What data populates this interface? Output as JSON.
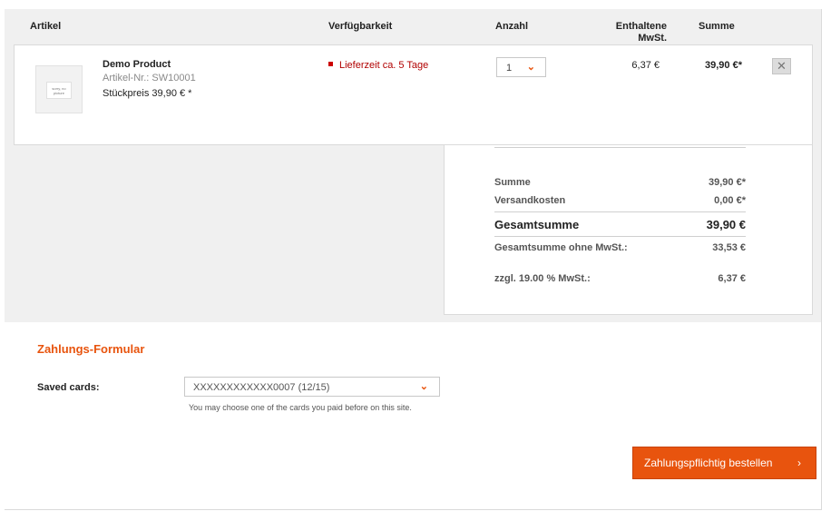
{
  "table_headers": {
    "article": "Artikel",
    "availability": "Verfügbarkeit",
    "quantity": "Anzahl",
    "tax": "Enthaltene MwSt.",
    "sum": "Summe"
  },
  "item": {
    "image_text": "sorry, no picture",
    "name": "Demo Product",
    "article_number": "Artikel-Nr.: SW10001",
    "unit_price": "Stückpreis 39,90 € *",
    "availability": "Lieferzeit ca. 5 Tage",
    "quantity": "1",
    "tax": "6,37 €",
    "sum": "39,90 €*",
    "delete_icon": "close-icon"
  },
  "totals": {
    "sum_label": "Summe",
    "sum_value": "39,90 €*",
    "shipping_label": "Versandkosten",
    "shipping_value": "0,00 €*",
    "grand_label": "Gesamtsumme",
    "grand_value": "39,90 €",
    "net_label": "Gesamtsumme ohne MwSt.:",
    "net_value": "33,53 €",
    "vat_label": "zzgl. 19.00 % MwSt.:",
    "vat_value": "6,37 €"
  },
  "payment": {
    "title": "Zahlungs-Formular",
    "saved_cards_label": "Saved cards:",
    "selected_card": "XXXXXXXXXXXX0007 (12/15)",
    "hint": "You may choose one of the cards you paid before on this site."
  },
  "order_button": {
    "label": "Zahlungspflichtig bestellen",
    "arrow": "›"
  },
  "colors": {
    "accent": "#e8540e",
    "availability": "#b10000"
  }
}
